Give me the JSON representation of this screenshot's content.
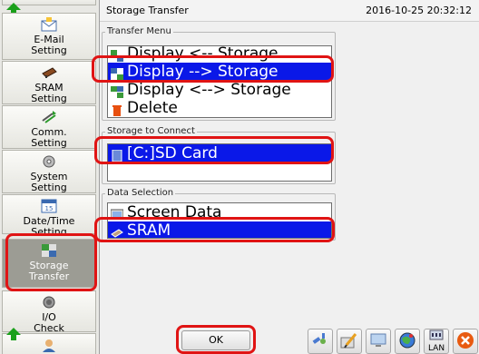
{
  "header": {
    "title": "Storage Transfer",
    "datetime": "2016-10-25 20:32:12"
  },
  "sidebar": {
    "items": [
      {
        "label1": "E-Mail",
        "label2": "Setting",
        "icon": "email-icon"
      },
      {
        "label1": "SRAM",
        "label2": "Setting",
        "icon": "sram-icon"
      },
      {
        "label1": "Comm.",
        "label2": "Setting",
        "icon": "comm-icon"
      },
      {
        "label1": "System",
        "label2": "Setting",
        "icon": "system-icon"
      },
      {
        "label1": "Date/Time",
        "label2": "Setting",
        "icon": "calendar-icon"
      },
      {
        "label1": "Storage",
        "label2": "Transfer",
        "icon": "storage-icon"
      },
      {
        "label1": "I/O",
        "label2": "Check",
        "icon": "io-icon"
      }
    ]
  },
  "transfer_menu": {
    "label": "Transfer Menu",
    "items": [
      "Display <-- Storage",
      "Display --> Storage",
      "Display <--> Storage",
      "Delete"
    ],
    "selected": 1
  },
  "storage_to_connect": {
    "label": "Storage to Connect",
    "items": [
      "[C:]SD Card"
    ],
    "selected": 0
  },
  "data_selection": {
    "label": "Data Selection",
    "items": [
      "Screen Data",
      "SRAM"
    ],
    "selected": 1
  },
  "footer": {
    "ok_label": "OK",
    "tools": [
      {
        "icon": "satellite-icon",
        "label": ""
      },
      {
        "icon": "pen-icon",
        "label": ""
      },
      {
        "icon": "monitor-icon",
        "label": ""
      },
      {
        "icon": "globe-icon",
        "label": ""
      },
      {
        "icon": "lan-icon",
        "label": "LAN"
      },
      {
        "icon": "close-icon",
        "label": ""
      }
    ]
  },
  "colors": {
    "selection": "#0a18e8",
    "highlight": "#e01414",
    "active_sidebar": "#9c9c94"
  }
}
